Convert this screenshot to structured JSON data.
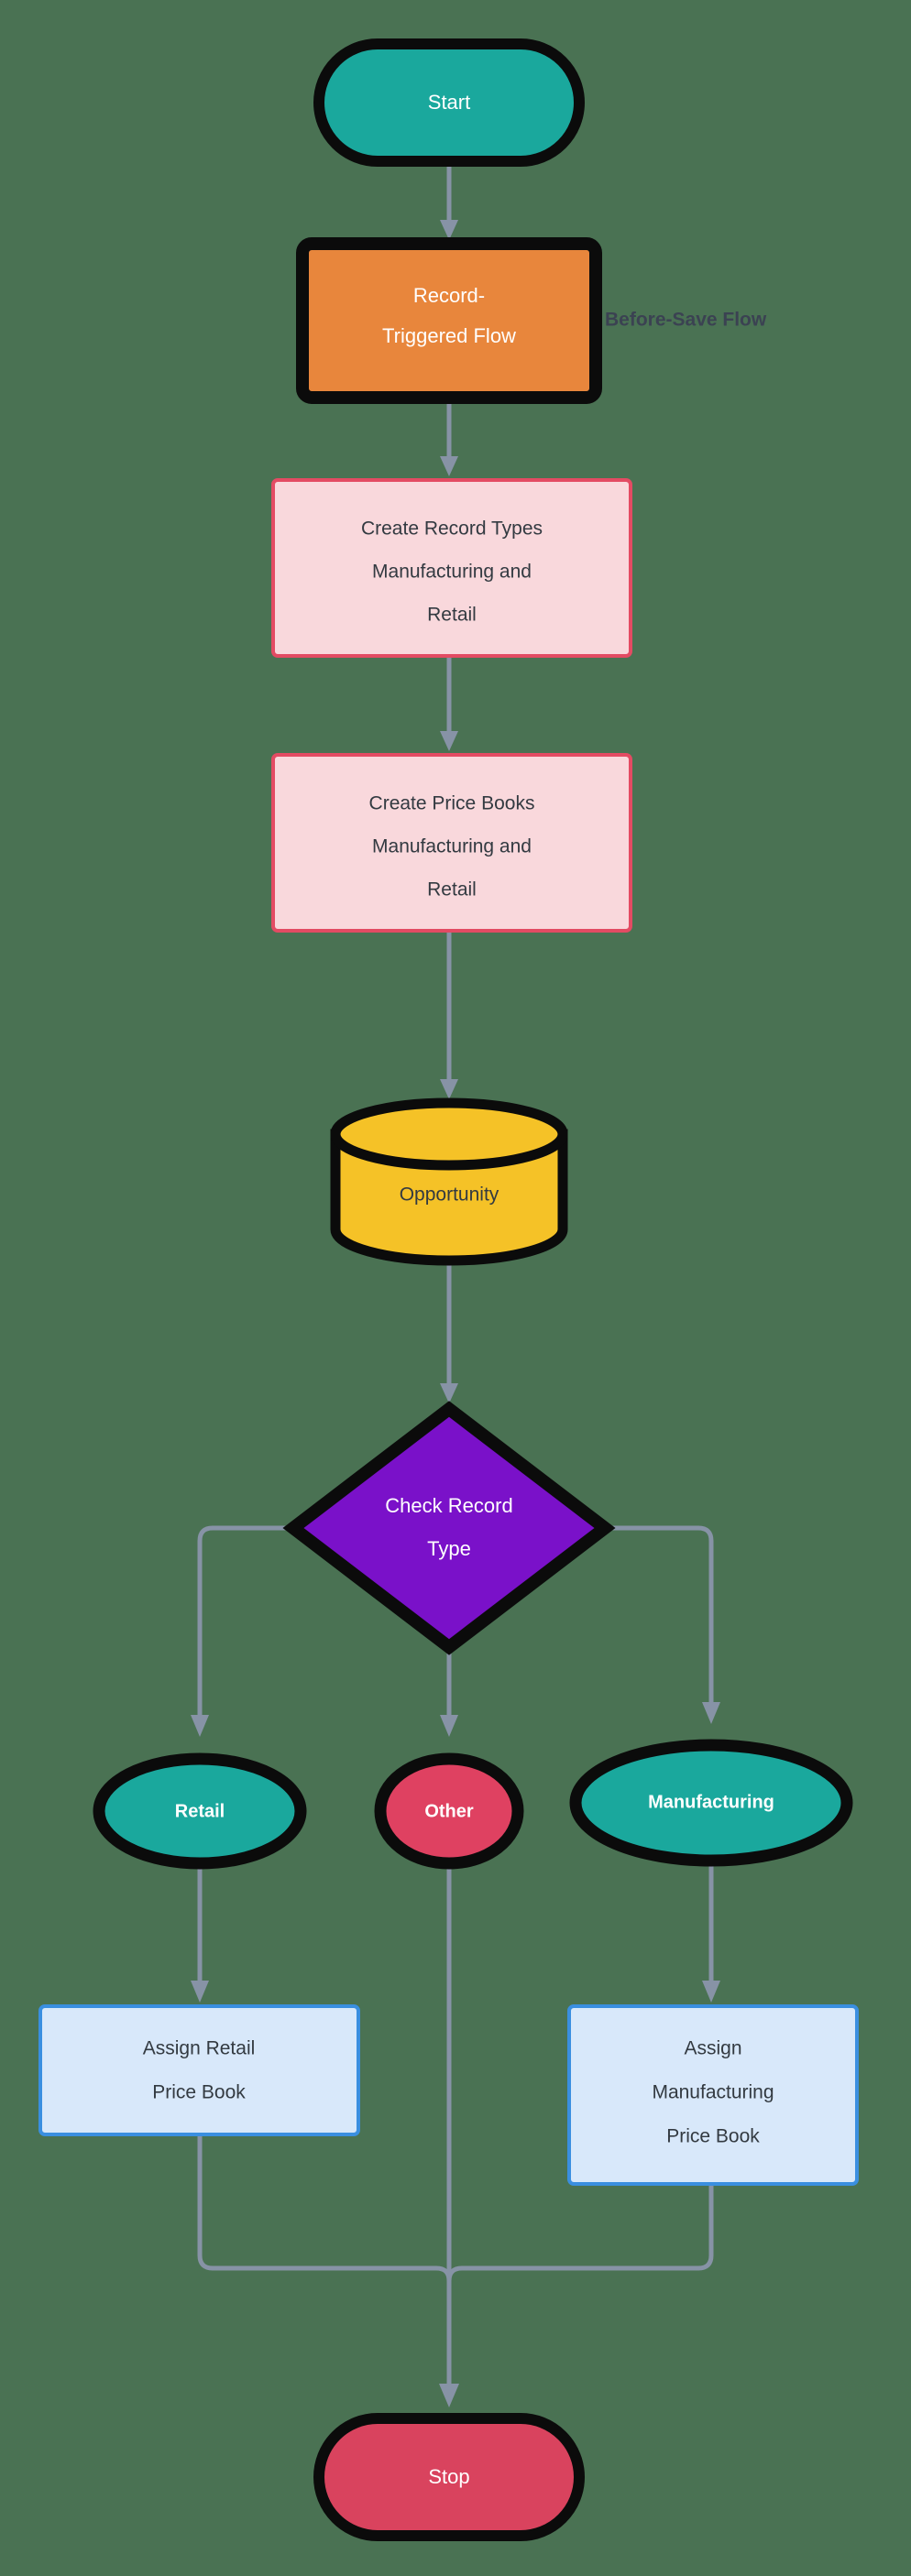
{
  "diagram": {
    "title": "Before-Save Flow",
    "background_color": "#4a7253",
    "cluster_label": "Before-Save Flow",
    "edge_color": "#8793a6"
  },
  "nodes": {
    "start": {
      "label": "Start",
      "shape": "stadium",
      "fill": "#1aa89d",
      "stroke": "#0b0b0b",
      "text_color": "#ffffff"
    },
    "record_triggered_flow": {
      "label_line1": "Record-",
      "label_line2": "Triggered Flow",
      "shape": "rect",
      "fill": "#e8863c",
      "stroke": "#0b0b0b",
      "text_color": "#ffffff"
    },
    "create_record_types": {
      "label_line1": "Create Record Types",
      "label_line2": "Manufacturing and",
      "label_line3": "Retail",
      "shape": "rect",
      "fill": "#f9d8dc",
      "stroke": "#e34b63",
      "text_color": "#333a41"
    },
    "create_price_books": {
      "label_line1": "Create Price Books",
      "label_line2": "Manufacturing and",
      "label_line3": "Retail",
      "shape": "rect",
      "fill": "#f9d8dc",
      "stroke": "#e34b63",
      "text_color": "#333a41"
    },
    "opportunity": {
      "label": "Opportunity",
      "shape": "cylinder",
      "fill": "#f5c227",
      "stroke": "#0b0b0b",
      "text_color": "#333a41"
    },
    "check_record_type": {
      "label_line1": "Check Record",
      "label_line2": "Type",
      "shape": "diamond",
      "fill": "#7a11c9",
      "stroke": "#0b0b0b",
      "text_color": "#ffffff"
    },
    "retail": {
      "label": "Retail",
      "shape": "ellipse",
      "fill": "#1aa89d",
      "stroke": "#0b0b0b",
      "text_color": "#ffffff"
    },
    "other": {
      "label": "Other",
      "shape": "ellipse",
      "fill": "#df4161",
      "stroke": "#0b0b0b",
      "text_color": "#ffffff"
    },
    "manufacturing": {
      "label": "Manufacturing",
      "shape": "ellipse",
      "fill": "#1aa89d",
      "stroke": "#0b0b0b",
      "text_color": "#ffffff"
    },
    "assign_retail_price_book": {
      "label_line1": "Assign Retail",
      "label_line2": "Price Book",
      "shape": "rect",
      "fill": "#d8e8fa",
      "stroke": "#3a8fe0",
      "text_color": "#333a41"
    },
    "assign_manufacturing_price_book": {
      "label_line1": "Assign",
      "label_line2": "Manufacturing",
      "label_line3": "Price Book",
      "shape": "rect",
      "fill": "#d8e8fa",
      "stroke": "#3a8fe0",
      "text_color": "#333a41"
    },
    "stop": {
      "label": "Stop",
      "shape": "stadium",
      "fill": "#d9435e",
      "stroke": "#0b0b0b",
      "text_color": "#ffffff"
    }
  },
  "edges": [
    {
      "from": "start",
      "to": "record_triggered_flow",
      "label": ""
    },
    {
      "from": "record_triggered_flow",
      "to": "create_record_types",
      "label": ""
    },
    {
      "from": "create_record_types",
      "to": "create_price_books",
      "label": ""
    },
    {
      "from": "create_price_books",
      "to": "opportunity",
      "label": ""
    },
    {
      "from": "opportunity",
      "to": "check_record_type",
      "label": ""
    },
    {
      "from": "check_record_type",
      "to": "retail",
      "label": ""
    },
    {
      "from": "check_record_type",
      "to": "other",
      "label": ""
    },
    {
      "from": "check_record_type",
      "to": "manufacturing",
      "label": ""
    },
    {
      "from": "retail",
      "to": "assign_retail_price_book",
      "label": ""
    },
    {
      "from": "manufacturing",
      "to": "assign_manufacturing_price_book",
      "label": ""
    },
    {
      "from": "assign_retail_price_book",
      "to": "stop",
      "label": ""
    },
    {
      "from": "other",
      "to": "stop",
      "label": ""
    },
    {
      "from": "assign_manufacturing_price_book",
      "to": "stop",
      "label": ""
    }
  ]
}
